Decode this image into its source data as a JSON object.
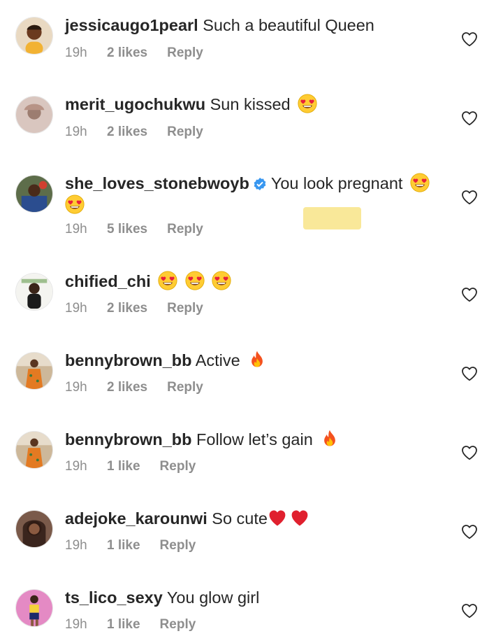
{
  "comments": [
    {
      "username": "jessicaugo1pearl",
      "text": "Such a beautiful Queen",
      "time": "19h",
      "likes": "2 likes",
      "reply": "Reply",
      "avatar_color": "#6b3a1f"
    },
    {
      "username": "merit_ugochukwu",
      "text": "Sun kissed",
      "time": "19h",
      "likes": "2 likes",
      "reply": "Reply",
      "avatar_color": "#c7a9a0"
    },
    {
      "username": "she_loves_stonebwoyb",
      "text": "You look pregnant",
      "time": "19h",
      "likes": "5 likes",
      "reply": "Reply",
      "avatar_color": "#2b4d8f"
    },
    {
      "username": "chified_chi",
      "text": "",
      "time": "19h",
      "likes": "2 likes",
      "reply": "Reply",
      "avatar_color": "#c8d8c0"
    },
    {
      "username": "bennybrown_bb",
      "text": "Active",
      "time": "19h",
      "likes": "2 likes",
      "reply": "Reply",
      "avatar_color": "#d98a3a"
    },
    {
      "username": "bennybrown_bb",
      "text": "Follow let’s gain",
      "time": "19h",
      "likes": "1 like",
      "reply": "Reply",
      "avatar_color": "#d98a3a"
    },
    {
      "username": "adejoke_karounwi",
      "text": "So cute",
      "time": "19h",
      "likes": "1 like",
      "reply": "Reply",
      "avatar_color": "#4a2e22"
    },
    {
      "username": "ts_lico_sexy",
      "text": "You glow girl",
      "time": "19h",
      "likes": "1 like",
      "reply": "Reply",
      "avatar_color": "#d44a9a"
    }
  ],
  "icons": {
    "heart": "heart-outline-icon",
    "verified": "verified-badge-icon",
    "emoji_love": "heart-eyes-emoji",
    "emoji_fire": "fire-emoji",
    "emoji_heart": "red-heart-emoji"
  },
  "colors": {
    "text": "#262626",
    "meta": "#8e8e8e",
    "verified": "#3897f0",
    "highlight": "#f8e58e"
  }
}
